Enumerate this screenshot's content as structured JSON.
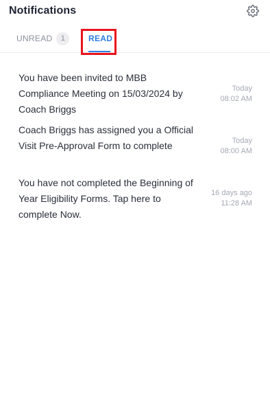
{
  "header": {
    "title": "Notifications",
    "settings_icon": "gear-icon"
  },
  "tabs": [
    {
      "label": "UNREAD",
      "count": "1",
      "active": false
    },
    {
      "label": "READ",
      "active": true
    }
  ],
  "colors": {
    "accent": "#2f7de1",
    "highlight_box": "#e8141c",
    "text": "#2a2e3a",
    "muted": "#a5a9b4"
  },
  "notifications": [
    {
      "message": "You have been invited to MBB Compliance Meeting on 15/03/2024 by Coach Briggs",
      "day": "Today",
      "time": "08:02 AM"
    },
    {
      "message": "Coach Briggs has assigned you a Official Visit Pre-Approval Form to complete",
      "day": "Today",
      "time": "08:00 AM"
    },
    {
      "message": "You have not completed the Beginning of Year Eligibility Forms. Tap here to complete Now.",
      "day": "16 days ago",
      "time": "11:28 AM"
    }
  ]
}
